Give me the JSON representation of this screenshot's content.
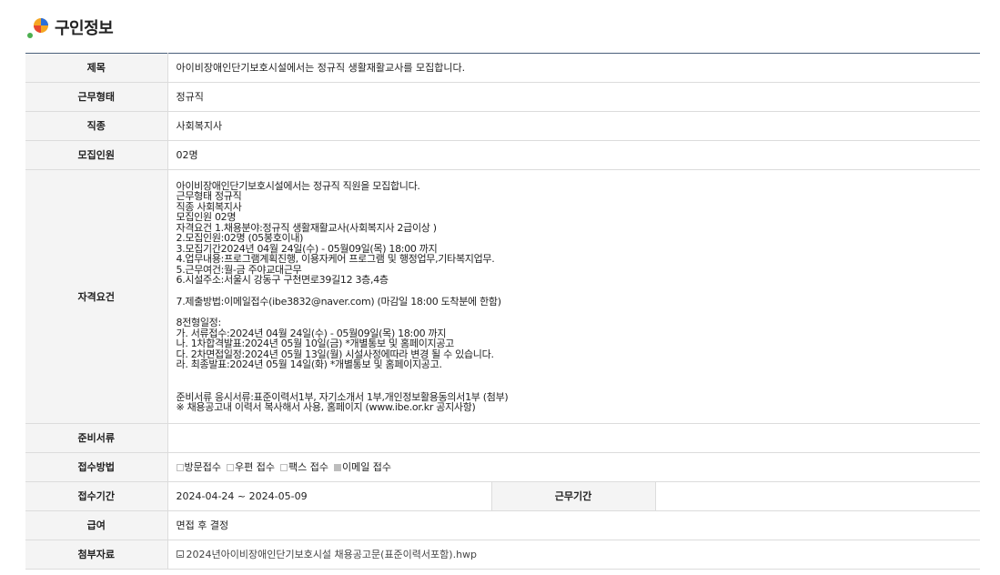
{
  "header": {
    "title": "구인정보"
  },
  "colors": {
    "header_rule": "#4a5f7b",
    "label_bg": "#f4f4f4",
    "border": "#dcdcdc",
    "logo_orange": "#f5a623",
    "logo_blue": "#2a6fdb",
    "logo_red": "#e8482f",
    "logo_green": "#4caf50"
  },
  "rows": {
    "title": {
      "label": "제목",
      "value": "아이비장애인단기보호시설에서는 정규직 생활재활교사를 모집합니다."
    },
    "work_type": {
      "label": "근무형태",
      "value": "정규직"
    },
    "job_type": {
      "label": "직종",
      "value": "사회복지사"
    },
    "headcount": {
      "label": "모집인원",
      "value": "02명"
    },
    "requirements": {
      "label": "자격요건",
      "lines": [
        "아이비장애인단기보호시설에서는 정규직 직원을 모집합니다.",
        "근무형태 정규직",
        "직종 사회복지사",
        "모집인원 02명",
        "자격요건 1.채용분야:정규직 생활재활교사(사회복지사 2급이상 )",
        "2.모집인원:02명 (05봉호이내)",
        "3.모집기간2024년 04월 24일(수) - 05월09일(목) 18:00 까지",
        "4.업무내용:프로그램계획진행, 이용자케어 프로그램 및 행정업무,기타복지업무.",
        "5.근무여건:월-금 주야교대근무",
        "6.시설주소:서울시 강동구 구천면로39길12 3층,4층",
        "7.제출방법:이메일접수(ibe3832@naver.com) (마감일 18:00 도착분에 한함)",
        "8전형일정:",
        "가. 서류접수:2024년 04월 24일(수) - 05월09일(목) 18:00 까지",
        "나. 1차합격발표:2024년 05월 10일(금) *개별통보 및 홈페이지공고",
        "다. 2차면접일정:2024년 05월 13일(월) 시설사정에따라 변경 될 수 있습니다.",
        "라. 최종발표:2024년 05월 14일(화) *개별통보 및 홈페이지공고.",
        "준비서류 응시서류:표준이력서1부, 자기소개서 1부,개인정보활용동의서1부 (첨부)",
        "※ 채용공고내 이력서 복사해서 사용, 홈페이지 (www.ibe.or.kr 공지사항)"
      ]
    },
    "documents": {
      "label": "준비서류",
      "value": ""
    },
    "method": {
      "label": "접수방법",
      "options": [
        {
          "label": "방문접수",
          "checked": false
        },
        {
          "label": "우편 접수",
          "checked": false
        },
        {
          "label": "팩스 접수",
          "checked": false
        },
        {
          "label": "이메일 접수",
          "checked": true
        }
      ]
    },
    "period": {
      "label": "접수기간",
      "value": "2024-04-24 ~ 2024-05-09",
      "work_period_label": "근무기간",
      "work_period_value": ""
    },
    "salary": {
      "label": "급여",
      "value": "면접 후 결정"
    },
    "attachment": {
      "label": "첨부자료",
      "file_name": "2024년아이비장애인단기보호시설 채용공고문(표준이력서포함).hwp"
    }
  }
}
